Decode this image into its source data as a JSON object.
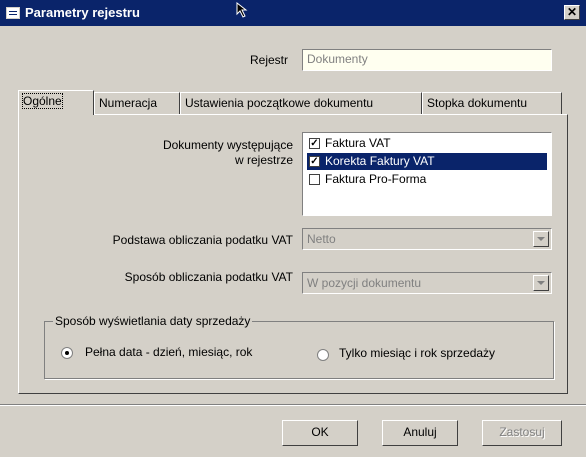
{
  "window": {
    "title": "Parametry rejestru",
    "close_glyph": "✕"
  },
  "rejestr": {
    "label": "Rejestr",
    "value": "Dokumenty"
  },
  "tabs": [
    {
      "label": "Ogólne"
    },
    {
      "label": "Numeracja"
    },
    {
      "label": "Ustawienia początkowe dokumentu"
    },
    {
      "label": "Stopka dokumentu"
    }
  ],
  "documents": {
    "label_line1": "Dokumenty występujące",
    "label_line2": "w rejestrze",
    "items": [
      {
        "label": "Faktura VAT",
        "checked": true,
        "check_glyph": "✓"
      },
      {
        "label": "Korekta Faktury VAT",
        "checked": true,
        "check_glyph": "✓"
      },
      {
        "label": "Faktura Pro-Forma",
        "checked": false,
        "check_glyph": ""
      }
    ]
  },
  "vat_base": {
    "label": "Podstawa obliczania podatku VAT",
    "value": "Netto"
  },
  "vat_method": {
    "label": "Sposób obliczania podatku VAT",
    "value": "W pozycji dokumentu"
  },
  "date_display": {
    "caption": "Sposób wyświetlania daty sprzedaży",
    "options": [
      {
        "label": "Pełna data -  dzień, miesiąc, rok",
        "selected": true
      },
      {
        "label": "Tylko miesiąc i rok sprzedaży",
        "selected": false
      }
    ]
  },
  "buttons": {
    "ok": "OK",
    "cancel": "Anuluj",
    "apply": "Zastosuj"
  }
}
